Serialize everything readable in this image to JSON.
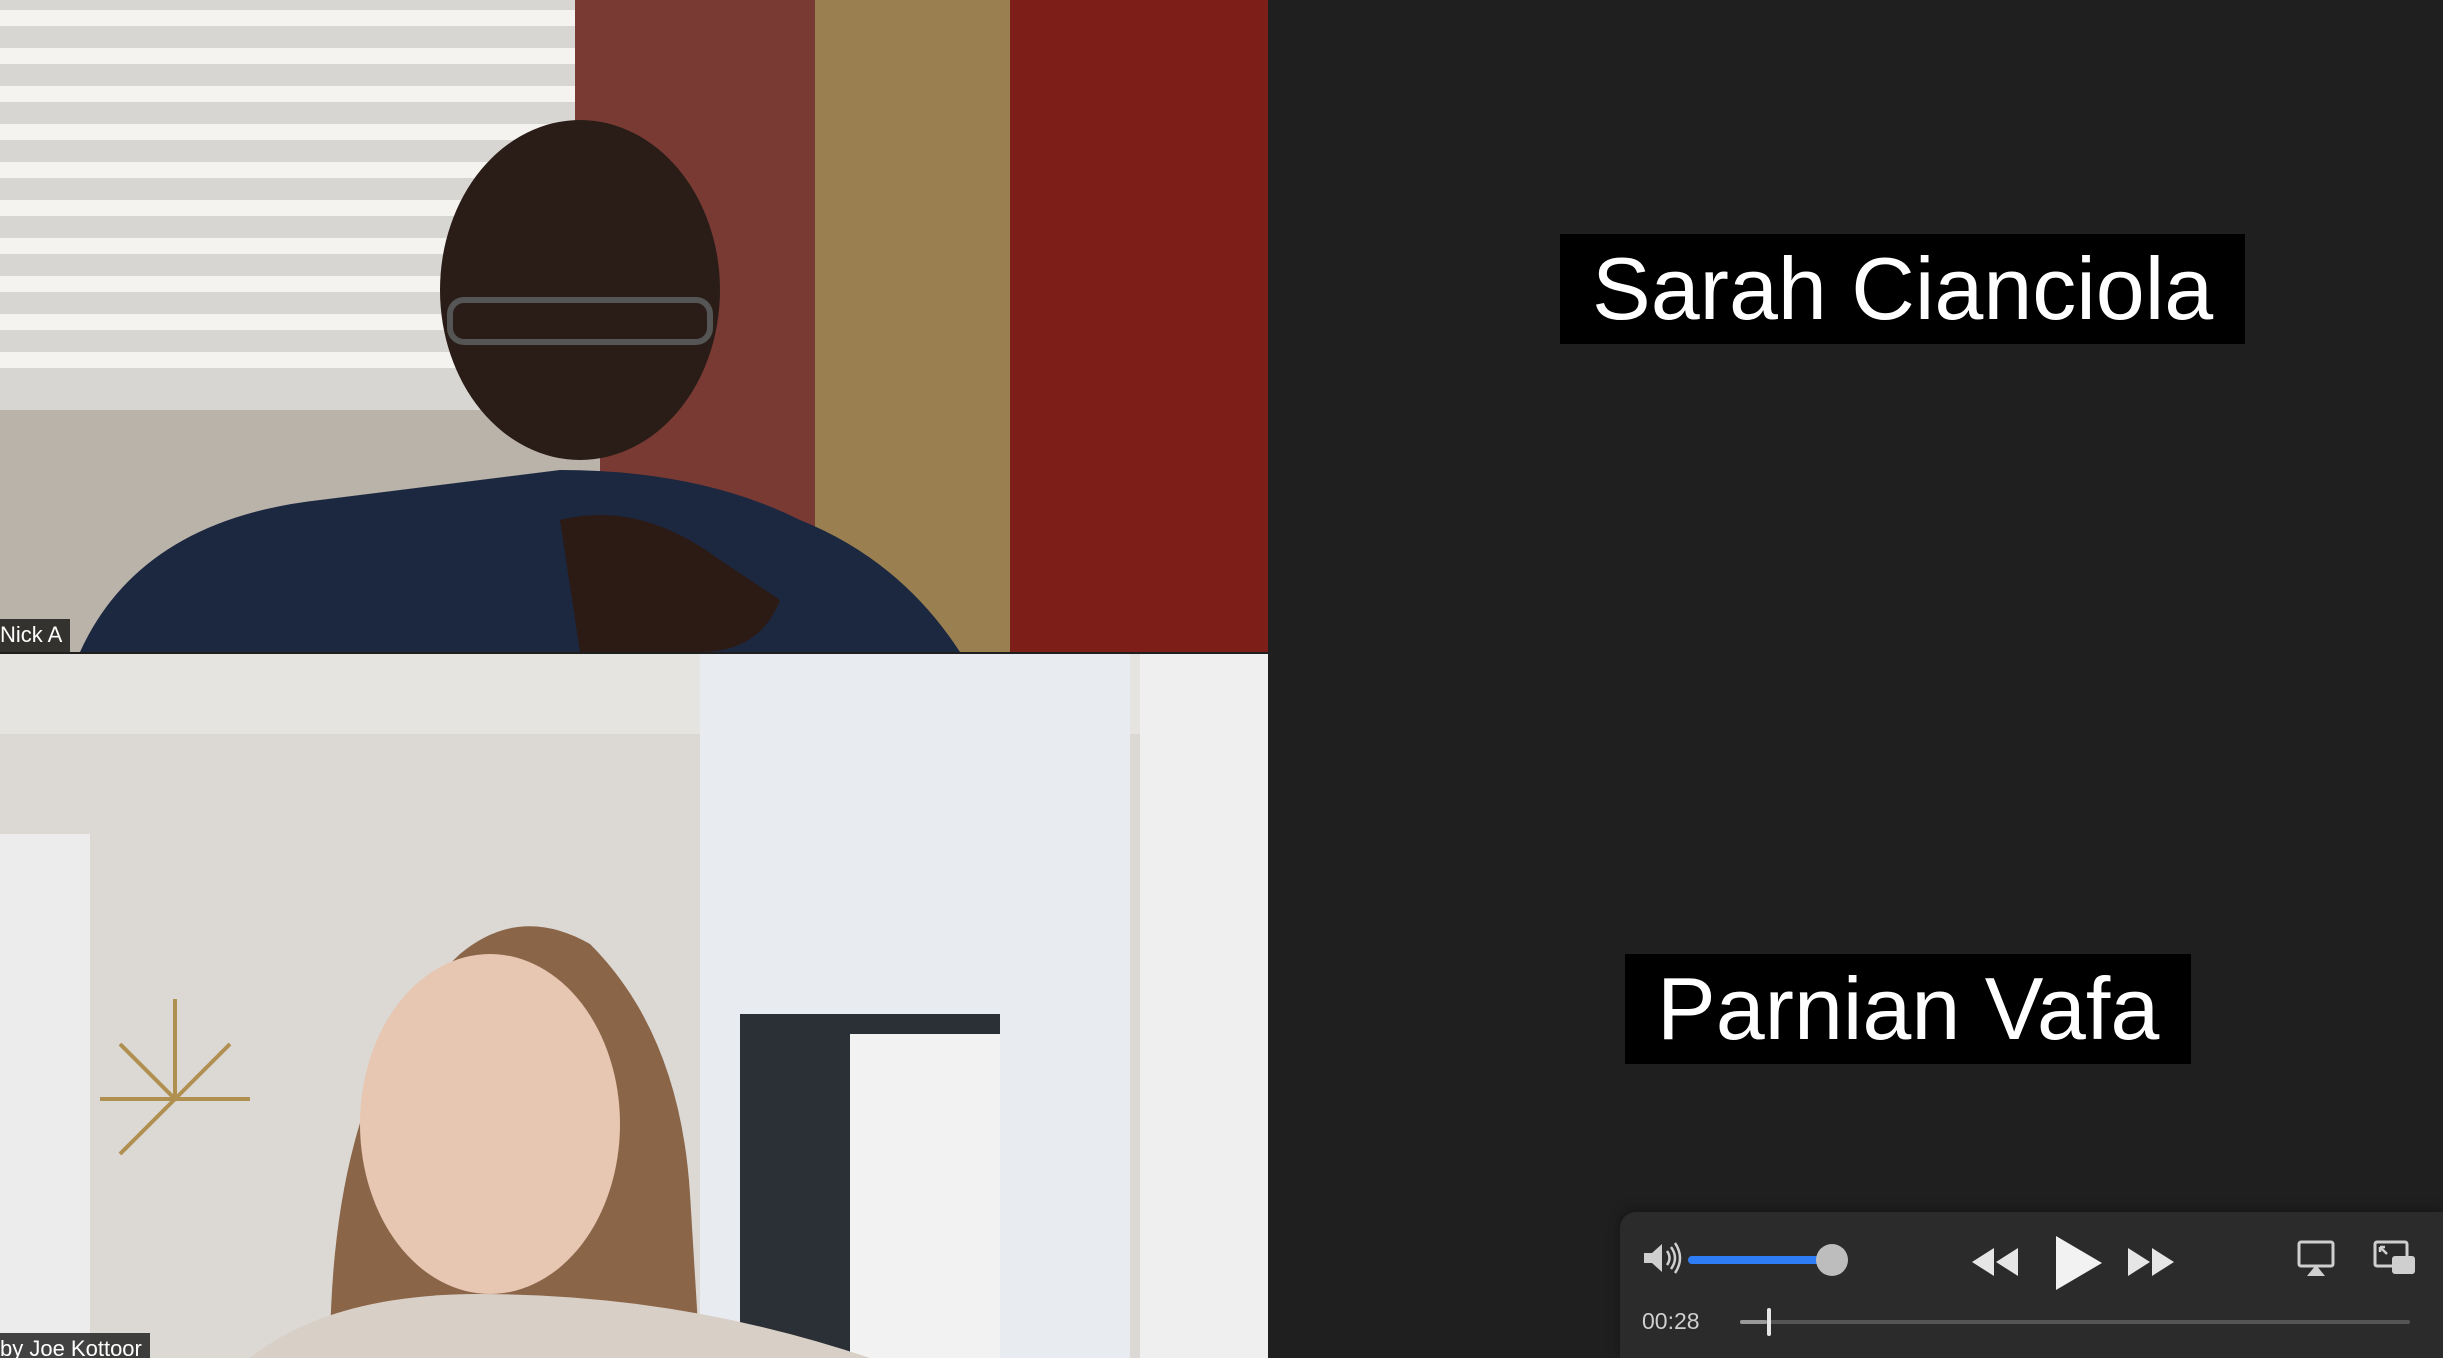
{
  "participants": [
    {
      "name_tag": "Nick A"
    },
    {
      "name_tag": "by Joe Kottoor"
    }
  ],
  "name_cards": [
    {
      "text": "Sarah Cianciola"
    },
    {
      "text": "Parnian Vafa"
    }
  ],
  "player": {
    "time": "00:28",
    "volume_level": 0.9,
    "playback_progress": 0.04,
    "icons": {
      "volume": "speaker-volume-icon",
      "rewind": "rewind-icon",
      "play": "play-icon",
      "fast_forward": "fast-forward-icon",
      "airplay": "airplay-icon",
      "picture_in_picture": "picture-in-picture-icon"
    }
  },
  "colors": {
    "background": "#1f1f1f",
    "player_bg": "#2b2b2b",
    "accent": "#2f7df6",
    "name_card_bg": "#000000"
  }
}
